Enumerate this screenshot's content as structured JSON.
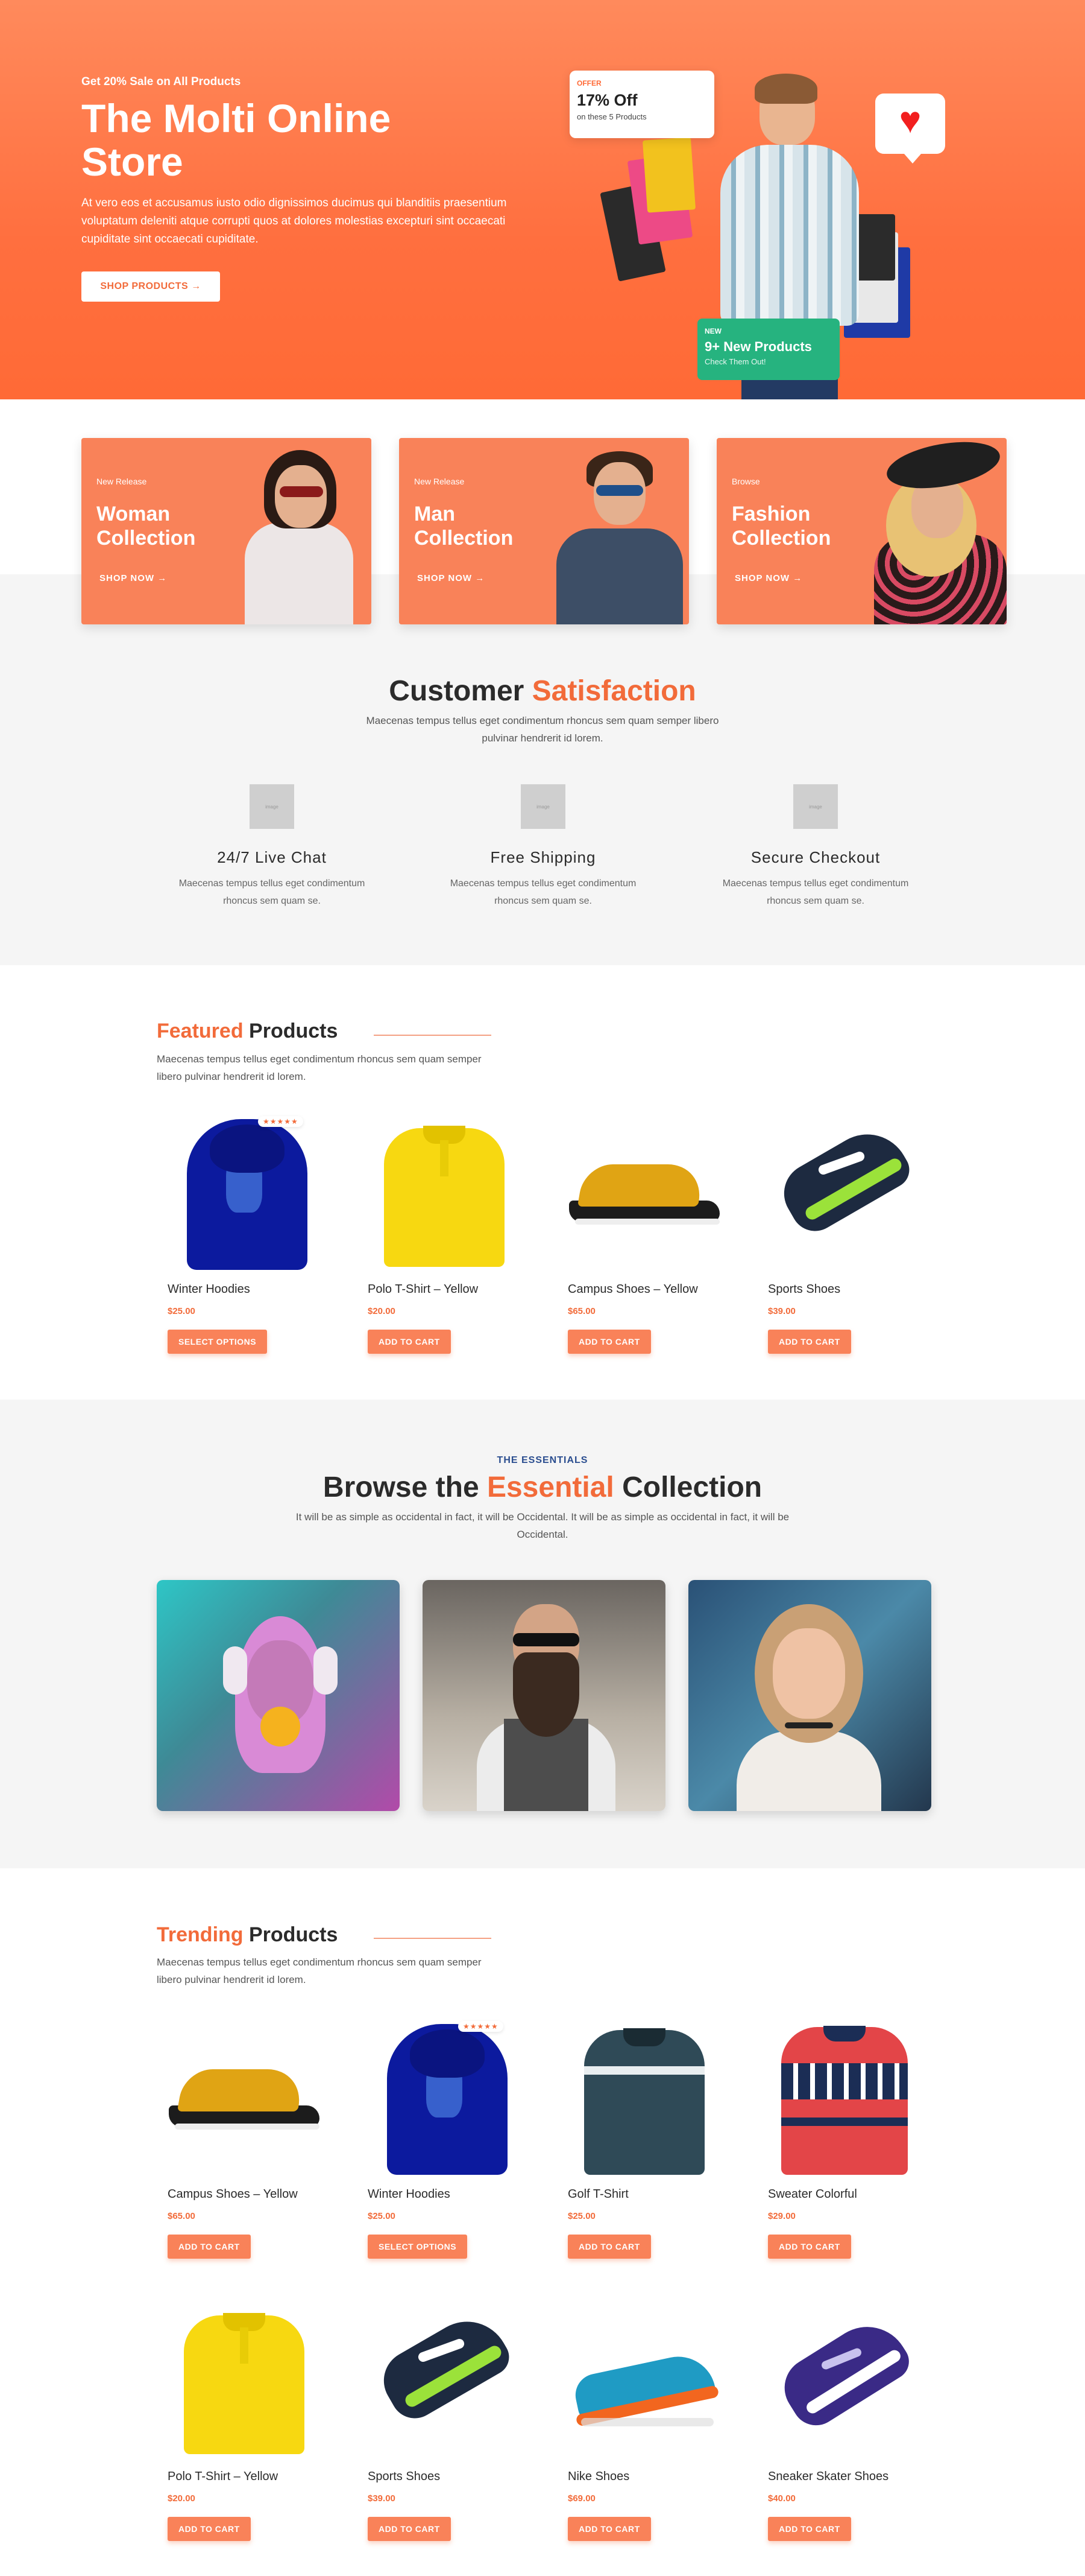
{
  "hero": {
    "kicker": "Get 20% Sale on All Products",
    "title": "The Molti Online Store",
    "description": "At vero eos et accusamus iusto odio dignissimos ducimus qui blanditiis praesentium voluptatum deleniti atque corrupti quos at dolores molestias excepturi sint occaecati cupiditate sint occaecati cupiditate.",
    "button": "SHOP PRODUCTS →",
    "offer": {
      "kicker": "OFFER",
      "title": "17% Off",
      "sub": "on these 5 Products"
    },
    "new_card": {
      "kicker": "NEW",
      "title": "9+ New Products",
      "sub": "Check Them Out!"
    },
    "heart_icon": "heart-icon"
  },
  "collections": [
    {
      "kicker": "New Release",
      "title": "Woman Collection",
      "link": "SHOP NOW →"
    },
    {
      "kicker": "New Release",
      "title": "Man Collection",
      "link": "SHOP NOW →"
    },
    {
      "kicker": "Browse",
      "title": "Fashion Collection",
      "link": "SHOP NOW →"
    }
  ],
  "satisfaction": {
    "title_a": "Customer ",
    "title_b": "Satisfaction",
    "subtitle": "Maecenas tempus tellus eget condimentum rhoncus sem quam semper libero pulvinar hendrerit id lorem.",
    "placeholder_text": "image",
    "features": [
      {
        "title": "24/7 Live Chat",
        "desc": "Maecenas tempus tellus eget condimentum rhoncus sem quam se."
      },
      {
        "title": "Free Shipping",
        "desc": "Maecenas tempus tellus eget condimentum rhoncus sem quam se."
      },
      {
        "title": "Secure Checkout",
        "desc": "Maecenas tempus tellus eget condimentum rhoncus sem quam se."
      }
    ]
  },
  "featured": {
    "title_a": "Featured",
    "title_b": " Products",
    "subtitle": "Maecenas tempus tellus eget condimentum rhoncus sem quam semper libero pulvinar hendrerit id lorem.",
    "rating_stars": "★★★★★",
    "products": [
      {
        "name": "Winter Hoodies",
        "price": "$25.00",
        "button": "SELECT OPTIONS"
      },
      {
        "name": "Polo T-Shirt – Yellow",
        "price": "$20.00",
        "button": "ADD TO CART"
      },
      {
        "name": "Campus Shoes – Yellow",
        "price": "$65.00",
        "button": "ADD TO CART"
      },
      {
        "name": "Sports Shoes",
        "price": "$39.00",
        "button": "ADD TO CART"
      }
    ]
  },
  "essentials": {
    "kicker": "THE ESSENTIALS",
    "title_a": "Browse the ",
    "title_b": "Essential",
    "title_c": " Collection",
    "subtitle": "It will be as simple as occidental in fact, it will be Occidental. It will be as simple as occidental in fact, it will be Occidental."
  },
  "trending": {
    "title_a": "Trending",
    "title_b": " Products",
    "subtitle": "Maecenas tempus tellus eget condimentum rhoncus sem quam semper libero pulvinar hendrerit id lorem.",
    "rating_stars": "★★★★★",
    "products": [
      {
        "name": "Campus Shoes – Yellow",
        "price": "$65.00",
        "button": "ADD TO CART"
      },
      {
        "name": "Winter Hoodies",
        "price": "$25.00",
        "button": "SELECT OPTIONS"
      },
      {
        "name": "Golf T-Shirt",
        "price": "$25.00",
        "button": "ADD TO CART"
      },
      {
        "name": "Sweater Colorful",
        "price": "$29.00",
        "button": "ADD TO CART"
      },
      {
        "name": "Polo T-Shirt – Yellow",
        "price": "$20.00",
        "button": "ADD TO CART"
      },
      {
        "name": "Sports Shoes",
        "price": "$39.00",
        "button": "ADD TO CART"
      },
      {
        "name": "Nike Shoes",
        "price": "$69.00",
        "button": "ADD TO CART"
      },
      {
        "name": "Sneaker Skater Shoes",
        "price": "$40.00",
        "button": "ADD TO CART"
      }
    ]
  },
  "colors": {
    "accent": "#f26b3a",
    "card": "#f98259",
    "hero": "#ff6f3f",
    "green": "#26b37f",
    "navy": "#2a4d8f"
  }
}
